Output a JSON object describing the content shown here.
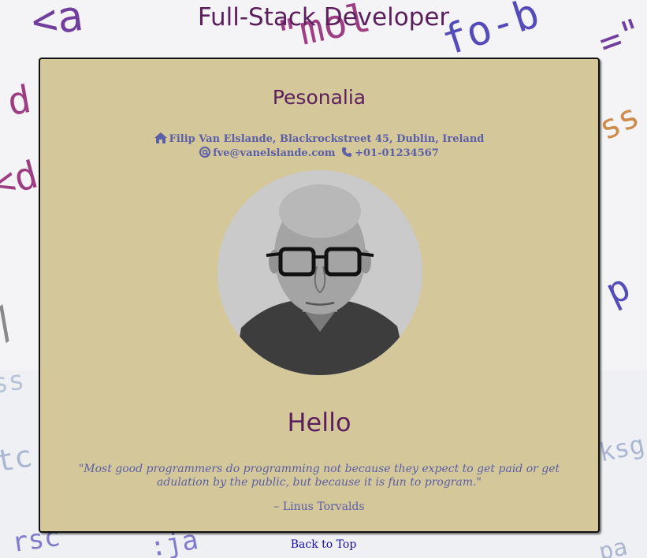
{
  "page": {
    "title": "Full-Stack Developer",
    "back_to_top": "Back to Top"
  },
  "personal": {
    "heading": "Pesonalia",
    "address": "Filip Van Elslande, Blackrockstreet 45, Dublin, Ireland",
    "email": "fve@vanelslande.com",
    "phone": "+01-01234567",
    "icons": [
      "home-icon",
      "at-icon",
      "phone-icon"
    ]
  },
  "intro": {
    "heading": "Hello",
    "quote": "\"Most good programmers do programming not because they expect to get paid or get adulation by the public, but because it is fun to program.\"",
    "author": "– Linus Torvalds"
  },
  "colors": {
    "title": "#5b1f5e",
    "card_background": "#d4c799",
    "contact_text": "#5b5fa8",
    "link": "#1a0dab"
  }
}
